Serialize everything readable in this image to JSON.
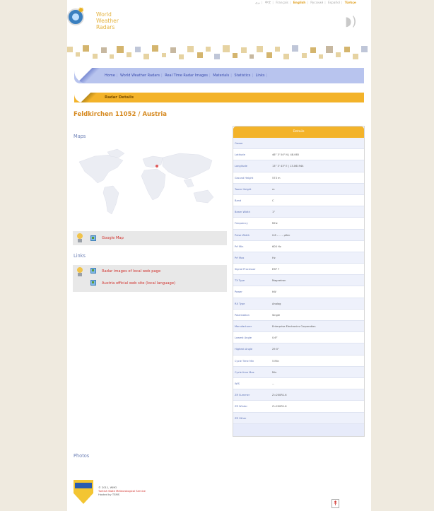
{
  "header": {
    "languages": [
      "بري",
      "中文",
      "Français",
      "English",
      "Русский",
      "Español",
      "Türkçe"
    ],
    "active_language": "English",
    "brand_lines": [
      "World",
      "Weather",
      "Radars"
    ]
  },
  "nav": {
    "items": [
      "Home",
      "World Weather Radars",
      "Real Time Radar Images",
      "Materials",
      "Statistics",
      "Links"
    ]
  },
  "details_bar": {
    "title": "Radar Details"
  },
  "radar": {
    "title": "Feldkirchen 11052 / Austria"
  },
  "maps": {
    "heading": "Maps",
    "google_link": "Google Map"
  },
  "links": {
    "heading": "Links",
    "items": [
      "Radar images of local web page",
      "Austria official web site (local language)"
    ]
  },
  "photos": {
    "heading": "Photos"
  },
  "details": {
    "header": "Details",
    "rows": [
      {
        "label": "Owner",
        "value": ""
      },
      {
        "label": "Latitude",
        "value": "46° 3' 54\" N | 48.065"
      },
      {
        "label": "Longitude",
        "value": "13° 3' 43\" E | 13.061944"
      },
      {
        "label": "Ground Height",
        "value": "573 m"
      },
      {
        "label": "Tower Height",
        "value": "m"
      },
      {
        "label": "Band",
        "value": "C"
      },
      {
        "label": "Beam Width",
        "value": "1°"
      },
      {
        "label": "Frequency",
        "value": "MHz"
      },
      {
        "label": "Pulse Width",
        "value": "0.8 - - - - µSec"
      },
      {
        "label": "Prf Min",
        "value": "600 Hz"
      },
      {
        "label": "Prf Max",
        "value": "Hz"
      },
      {
        "label": "Signal Processor",
        "value": "ESP 7"
      },
      {
        "label": "TX Type",
        "value": "Magnetron"
      },
      {
        "label": "Power",
        "value": "kW"
      },
      {
        "label": "RX Type",
        "value": "Analog"
      },
      {
        "label": "Polarization",
        "value": "Single"
      },
      {
        "label": "Manufacturer",
        "value": "Enterprise Electronics Corporation"
      },
      {
        "label": "Lowest Angle",
        "value": "0.6°"
      },
      {
        "label": "Highest Angle",
        "value": "29.5°"
      },
      {
        "label": "Cycle Time Min",
        "value": "5 Min"
      },
      {
        "label": "Cycle time Max",
        "value": "Min"
      },
      {
        "label": "WIS",
        "value": "..."
      },
      {
        "label": "ZR Summer",
        "value": "Z=200R1.6"
      },
      {
        "label": "ZR Winter",
        "value": "Z=200R1.6"
      },
      {
        "label": "ZR Other",
        "value": ""
      }
    ]
  },
  "footer": {
    "lines": [
      "© 2011, WMO",
      "Turkish State Meteorological Service",
      "Hosted by TSMS"
    ]
  },
  "colors": {
    "accent": "#f3b32a",
    "nav": "#b8c4ee",
    "link": "#d1322d",
    "title": "#d68a21"
  }
}
